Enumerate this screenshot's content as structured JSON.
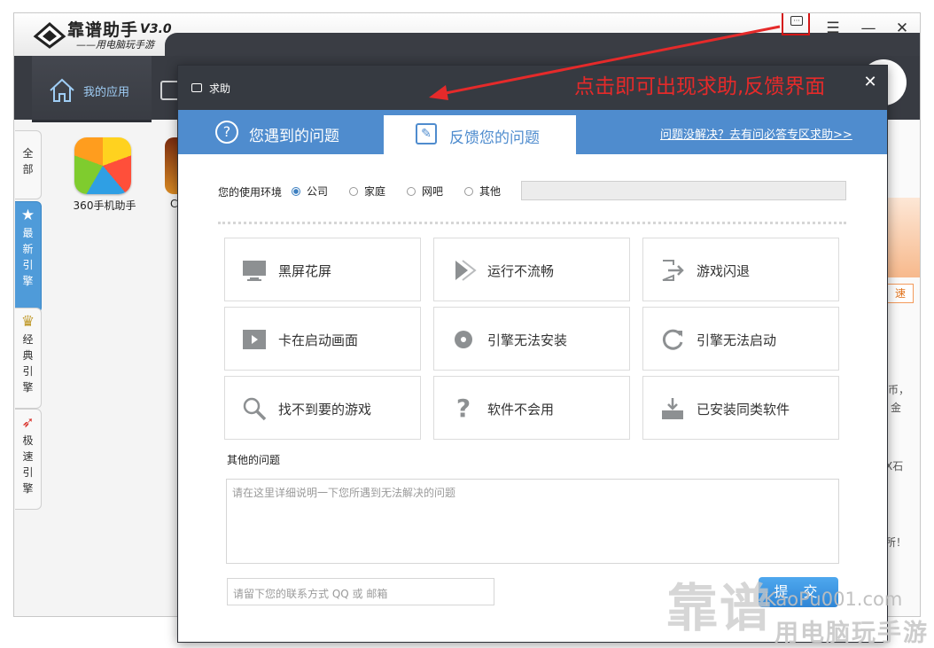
{
  "app": {
    "title": "靠谱助手",
    "version": "V3.0",
    "slogan": "——用电脑玩手游",
    "nav_my_apps": "我的应用",
    "window_buttons": {
      "feedback_icon": "feedback-icon",
      "menu": "☰",
      "minimize": "—",
      "close": "✕"
    },
    "side_tabs": [
      "全部",
      "最新引擎",
      "经典引擎",
      "极速引擎"
    ],
    "apps": [
      {
        "label": "360手机助手"
      },
      {
        "label": "C"
      }
    ],
    "right_fragments": [
      "速",
      "币，",
      "金",
      "X石",
      "所！"
    ]
  },
  "dialog": {
    "title": "求助",
    "close": "✕",
    "tabs": [
      {
        "label": "您遇到的问题",
        "icon": "question-circle-icon"
      },
      {
        "label": "反馈您的问题",
        "icon": "edit-icon"
      }
    ],
    "help_link": "问题没解决？去有问必答专区求助>>",
    "env_label": "您的使用环境",
    "env_options": [
      "公司",
      "家庭",
      "网吧",
      "其他"
    ],
    "env_selected": "公司",
    "issues": [
      {
        "label": "黑屏花屏",
        "icon": "monitor-icon"
      },
      {
        "label": "运行不流畅",
        "icon": "play-arrow-icon"
      },
      {
        "label": "游戏闪退",
        "icon": "exit-icon"
      },
      {
        "label": "卡在启动画面",
        "icon": "video-icon"
      },
      {
        "label": "引擎无法安装",
        "icon": "disc-icon"
      },
      {
        "label": "引擎无法启动",
        "icon": "refresh-icon"
      },
      {
        "label": "找不到要的游戏",
        "icon": "search-icon"
      },
      {
        "label": "软件不会用",
        "icon": "question-icon"
      },
      {
        "label": "已安装同类软件",
        "icon": "install-icon"
      }
    ],
    "other_title": "其他的问题",
    "desc_placeholder": "请在这里详细说明一下您所遇到无法解决的问题",
    "contact_placeholder": "请留下您的联系方式 QQ 或 邮箱",
    "submit": "提 交"
  },
  "annotation": {
    "text": "点击即可出现求助,反馈界面",
    "color": "#e52a2a"
  },
  "watermark": {
    "big": "靠谱",
    "url": "KaoPu001.com",
    "sub": "用电脑玩手游"
  },
  "colors": {
    "accent": "#4f8cce",
    "titlebar_dark": "#363a41",
    "annotation": "#d41616"
  }
}
